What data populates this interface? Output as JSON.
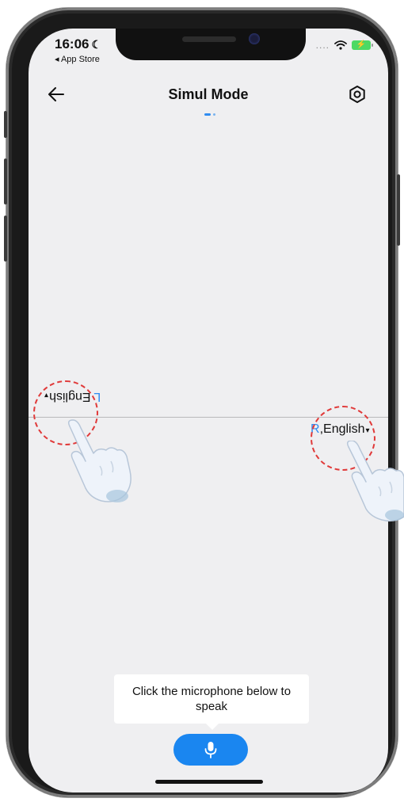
{
  "status_bar": {
    "time": "16:06",
    "back_app": "◂ App Store",
    "signal_dots": "....",
    "battery_level": 1.0,
    "battery_charging": true
  },
  "nav": {
    "title": "Simul Mode",
    "back_icon": "arrow-left-icon",
    "settings_icon": "gear-icon"
  },
  "page_indicator": {
    "count": 2,
    "active": 0,
    "accent": "#2f8cf1"
  },
  "languages": {
    "left": {
      "side": "L",
      "name": "English",
      "caret": "▾"
    },
    "right": {
      "side": "R",
      "name": "English",
      "caret": "▾"
    }
  },
  "tooltip": {
    "text": "Click the microphone below to speak"
  },
  "mic": {
    "icon": "microphone-icon",
    "color": "#1a86f0"
  },
  "colors": {
    "accent": "#2f8cf1",
    "hint_circle": "#e03a3a",
    "background": "#efeff1"
  }
}
